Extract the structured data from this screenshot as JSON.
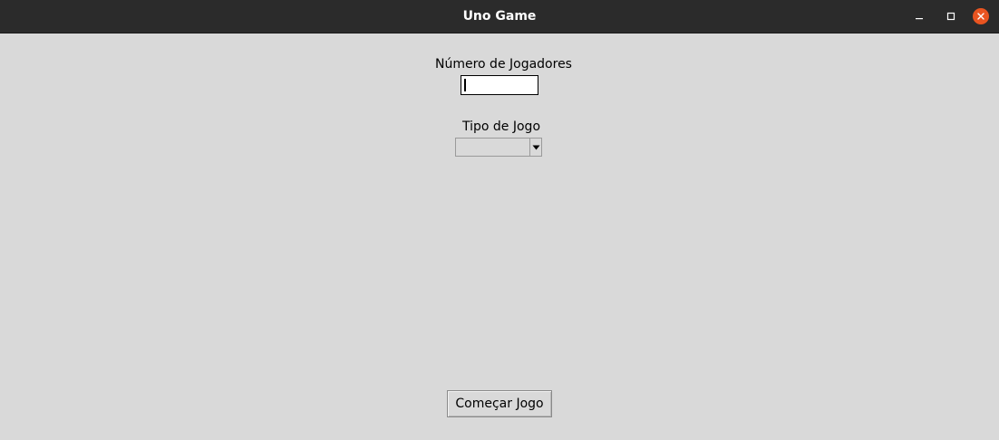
{
  "window": {
    "title": "Uno Game",
    "controls": {
      "minimize_icon": "minimize-icon",
      "maximize_icon": "maximize-icon",
      "close_icon": "close-icon"
    },
    "close_color": "#e95420"
  },
  "form": {
    "players_label": "Número de Jogadores",
    "players_value": "",
    "game_type_label": "Tipo de Jogo",
    "game_type_value": "",
    "start_button_label": "Começar Jogo"
  },
  "colors": {
    "background": "#d9d9d9",
    "titlebar": "#2b2b2b"
  }
}
